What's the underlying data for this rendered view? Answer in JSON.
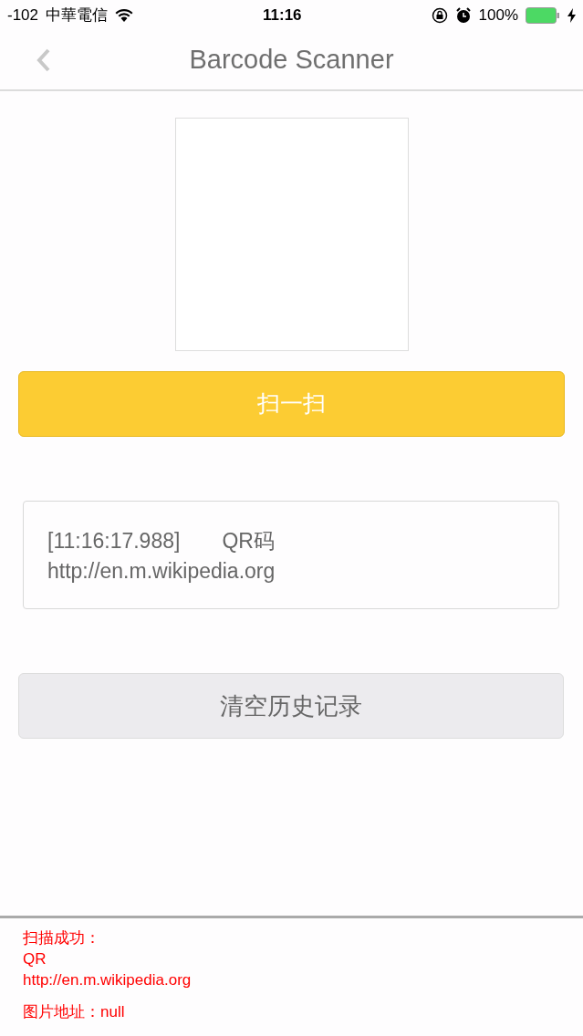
{
  "status_bar": {
    "signal": "-102",
    "carrier": "中華電信",
    "time": "11:16",
    "battery": "100%"
  },
  "nav": {
    "title": "Barcode Scanner"
  },
  "scan_button": {
    "label": "扫一扫"
  },
  "history": [
    {
      "time": "[11:16:17.988]",
      "type": "QR码",
      "content": "http://en.m.wikipedia.org"
    }
  ],
  "clear_button": {
    "label": "清空历史记录"
  },
  "log": [
    {
      "lines": [
        "扫描成功：",
        "QR",
        "http://en.m.wikipedia.org"
      ]
    },
    {
      "lines": [
        "图片地址：null"
      ]
    }
  ]
}
